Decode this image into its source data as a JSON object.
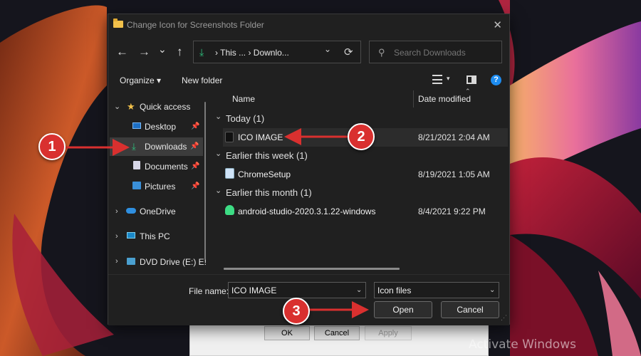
{
  "dialog": {
    "title": "Change Icon for Screenshots Folder",
    "close_glyph": "✕"
  },
  "nav": {
    "back_glyph": "←",
    "forward_glyph": "→",
    "recent_glyph": "⌄",
    "up_glyph": "↑",
    "breadcrumb": "›  This ...  ›  Downlo...",
    "address_chevron": "⌄",
    "refresh_glyph": "⟳",
    "search_placeholder": "Search Downloads"
  },
  "toolbar": {
    "organize": "Organize ▾",
    "new_folder": "New folder",
    "help": "?"
  },
  "sidebar": {
    "quick_access": "Quick access",
    "items": [
      {
        "label": "Desktop"
      },
      {
        "label": "Downloads"
      },
      {
        "label": "Documents"
      },
      {
        "label": "Pictures"
      }
    ],
    "onedrive": "OneDrive",
    "this_pc": "This PC",
    "dvd": "DVD Drive (E:) E!"
  },
  "columns": {
    "name": "Name",
    "date_modified": "Date modified"
  },
  "groups": [
    {
      "label": "Today (1)",
      "file": "ICO IMAGE",
      "date": "8/21/2021 2:04 AM"
    },
    {
      "label": "Earlier this week (1)",
      "file": "ChromeSetup",
      "date": "8/19/2021 1:05 AM"
    },
    {
      "label": "Earlier this month (1)",
      "file": "android-studio-2020.3.1.22-windows",
      "date": "8/4/2021 9:22 PM"
    }
  ],
  "footer": {
    "file_name_label": "File name:",
    "file_name_value": "ICO IMAGE",
    "file_type": "Icon files",
    "open": "Open",
    "cancel": "Cancel"
  },
  "background_dialog": {
    "ok": "OK",
    "cancel": "Cancel",
    "apply": "Apply"
  },
  "annotations": {
    "step1": "1",
    "step2": "2",
    "step3": "3"
  },
  "watermark": "Activate Windows",
  "colors": {
    "accent_green": "#2ec27e",
    "annotation_red": "#d9302f",
    "help_blue": "#1d8cf0",
    "folder_yellow": "#f2c14b"
  }
}
